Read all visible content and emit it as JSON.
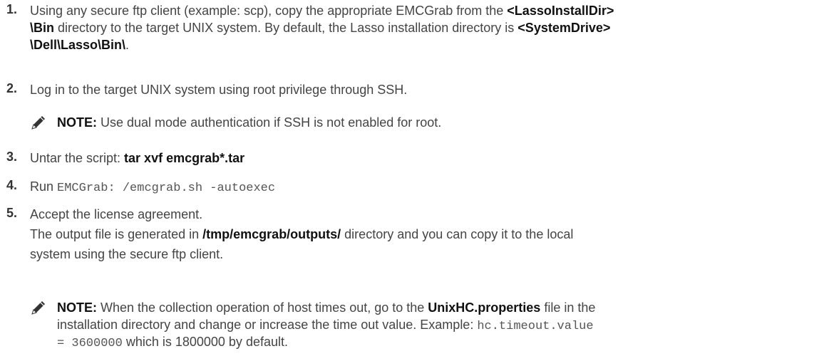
{
  "steps": [
    {
      "num": "1.",
      "lines": [
        {
          "a": "Using any secure ftp client (example: scp), copy the appropriate EMCGrab from the ",
          "b": "<LassoInstallDir>"
        },
        {
          "b": "\\Bin",
          "a": " directory to the target UNIX system. By default, the Lasso installation directory is ",
          "b2": "<SystemDrive>"
        },
        {
          "b": "\\Dell\\Lasso\\Bin\\",
          "a": "."
        }
      ]
    },
    {
      "num": "2.",
      "text": "Log in to the target UNIX system using root privilege through SSH."
    },
    {
      "note_label": "NOTE:",
      "note_text": " Use dual mode authentication if SSH is not enabled for root."
    },
    {
      "num": "3.",
      "a": "Untar the script: ",
      "b": "tar xvf emcgrab*.tar"
    },
    {
      "num": "4.",
      "a": "Run ",
      "code": "EMCGrab: /emcgrab.sh -autoexec"
    },
    {
      "num": "5.",
      "text": "Accept the license agreement.",
      "p2a": "The output file is generated in ",
      "p2b": "/tmp/emcgrab/outputs/",
      "p2c": " directory and you can copy it to the local",
      "p3": "system using the secure ftp client."
    },
    {
      "note_label": "NOTE:",
      "l1a": " When the collection operation of host times out, go to the ",
      "l1b": "UnixHC.properties",
      "l1c": " file in the",
      "l2a": "installation directory and change or increase the time out value. Example: ",
      "l2code": "hc.timeout.value",
      "l3code": "= 3600000",
      "l3a": " which is 1800000 by default."
    }
  ]
}
